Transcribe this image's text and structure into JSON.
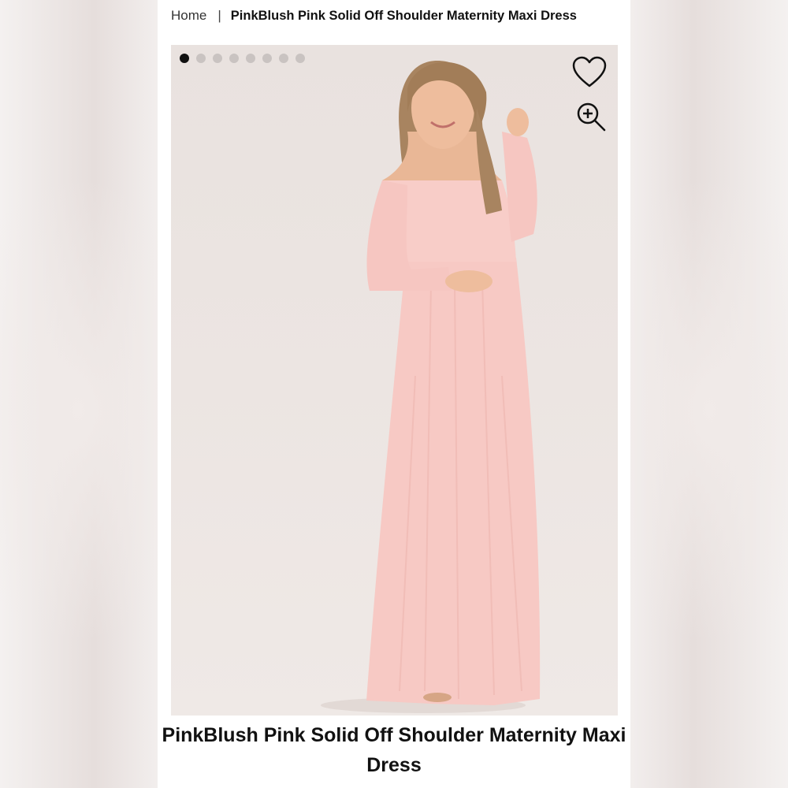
{
  "breadcrumb": {
    "home_label": "Home",
    "separator": "|",
    "current_label": "PinkBlush Pink Solid Off Shoulder Maternity Maxi Dress"
  },
  "gallery": {
    "image_count": 8,
    "active_index": 0,
    "icons": {
      "favorite": "heart-icon",
      "zoom": "zoom-in-icon"
    },
    "colors": {
      "dress": "#f7c9c4",
      "active_dot": "#111111",
      "inactive_dot": "#c9c3c1"
    }
  },
  "product": {
    "title": "PinkBlush Pink Solid Off Shoulder Maternity Maxi Dress"
  }
}
